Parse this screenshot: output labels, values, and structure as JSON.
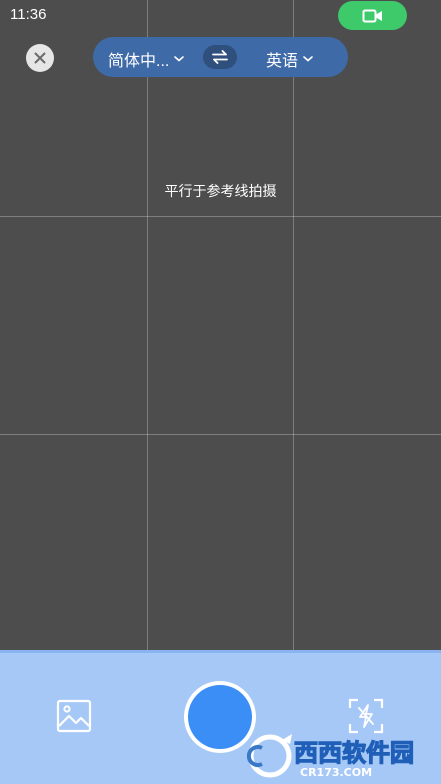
{
  "status_bar": {
    "time": "11:36"
  },
  "language_selector": {
    "source": "简体中...",
    "target": "英语"
  },
  "hint": "平行于参考线拍摄",
  "watermark": {
    "brand": "西西软件园",
    "site": "CR173.COM"
  },
  "icons": {
    "video": "video-camera-icon",
    "close": "close-icon",
    "swap": "swap-arrows-icon",
    "chevron": "chevron-down-icon",
    "gallery": "gallery-image-icon",
    "flash": "flash-off-icon"
  },
  "colors": {
    "camera_background": "#4d4d4d",
    "video_pill": "#3ec96b",
    "language_bar": "#3f6aa8",
    "bottom_panel": "#a6c8f7",
    "shutter": "#3a8ef5"
  }
}
